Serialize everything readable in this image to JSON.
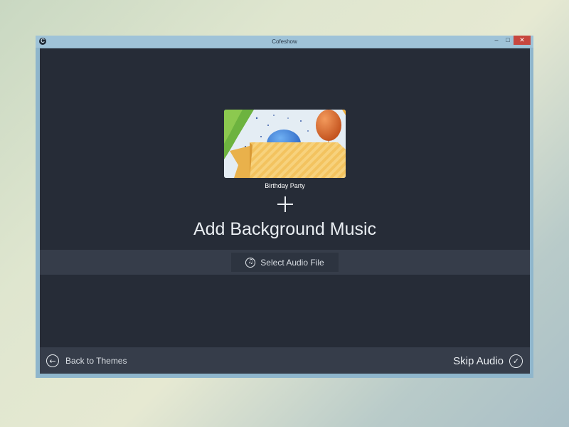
{
  "window": {
    "title": "Cofeshow",
    "controls": {
      "minimize": "–",
      "maximize": "□",
      "close": "✕"
    }
  },
  "theme": {
    "label": "Birthday Party"
  },
  "main": {
    "heading": "Add Background Music",
    "select_audio_label": "Select Audio File"
  },
  "footer": {
    "back_label": "Back to Themes",
    "skip_label": "Skip Audio"
  },
  "colors": {
    "content_bg": "#262c37",
    "band_bg": "#363d4a",
    "close_red": "#c7463e"
  },
  "icons": {
    "app": "cofeshow-logo-icon",
    "select_audio": "music-note-icon",
    "back": "arrow-left-circle-icon",
    "skip": "checkmark-circle-icon"
  }
}
